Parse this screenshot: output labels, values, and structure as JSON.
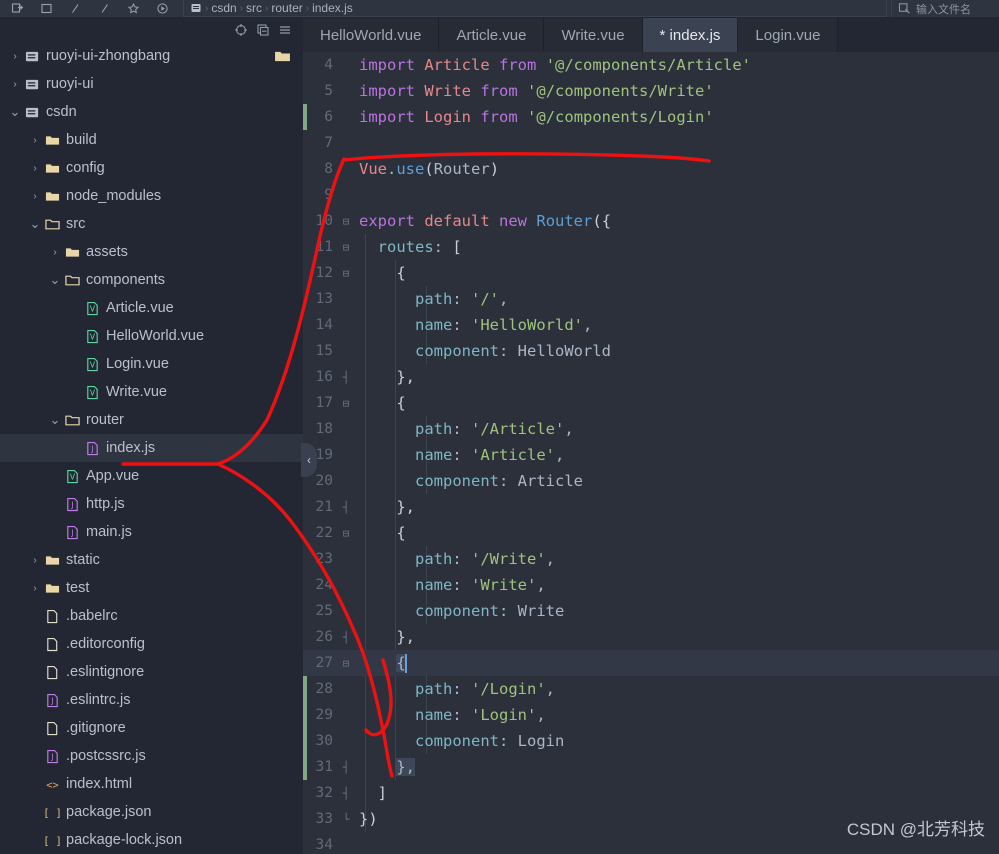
{
  "topbar": {
    "icons": [
      "add-frame-icon",
      "window-icon",
      "backslash-icon",
      "slash-icon",
      "star-icon",
      "run-icon"
    ],
    "breadcrumb_icon": "project-file-icon",
    "breadcrumbs": [
      "csdn",
      "src",
      "router",
      "index.js"
    ],
    "crumb_separator": "›",
    "search_icon": "search-file-icon",
    "search_placeholder": "输入文件名"
  },
  "project_panel": {
    "toolbar_icons": [
      "locate-target-icon",
      "collapse-all-icon",
      "options-menu-icon"
    ],
    "tree": [
      {
        "label": "ruoyi-ui-zhongbang",
        "depth": 0,
        "arrow": "›",
        "icon": "module-icon",
        "selected": false,
        "trailing_icon": "folder-icon"
      },
      {
        "label": "ruoyi-ui",
        "depth": 0,
        "arrow": "›",
        "icon": "module-icon",
        "selected": false
      },
      {
        "label": "csdn",
        "depth": 0,
        "arrow": "⌄",
        "icon": "module-icon",
        "selected": false
      },
      {
        "label": "build",
        "depth": 1,
        "arrow": "›",
        "icon": "folder-icon",
        "selected": false
      },
      {
        "label": "config",
        "depth": 1,
        "arrow": "›",
        "icon": "folder-icon",
        "selected": false
      },
      {
        "label": "node_modules",
        "depth": 1,
        "arrow": "›",
        "icon": "folder-icon",
        "selected": false
      },
      {
        "label": "src",
        "depth": 1,
        "arrow": "⌄",
        "icon": "folder-open-icon",
        "selected": false
      },
      {
        "label": "assets",
        "depth": 2,
        "arrow": "›",
        "icon": "folder-icon",
        "selected": false
      },
      {
        "label": "components",
        "depth": 2,
        "arrow": "⌄",
        "icon": "folder-open-icon",
        "selected": false
      },
      {
        "label": "Article.vue",
        "depth": 3,
        "arrow": "",
        "icon": "vue-file-icon",
        "selected": false
      },
      {
        "label": "HelloWorld.vue",
        "depth": 3,
        "arrow": "",
        "icon": "vue-file-icon",
        "selected": false
      },
      {
        "label": "Login.vue",
        "depth": 3,
        "arrow": "",
        "icon": "vue-file-icon",
        "selected": false
      },
      {
        "label": "Write.vue",
        "depth": 3,
        "arrow": "",
        "icon": "vue-file-icon",
        "selected": false
      },
      {
        "label": "router",
        "depth": 2,
        "arrow": "⌄",
        "icon": "folder-open-icon",
        "selected": false
      },
      {
        "label": "index.js",
        "depth": 3,
        "arrow": "",
        "icon": "js-file-icon",
        "selected": true
      },
      {
        "label": "App.vue",
        "depth": 2,
        "arrow": "",
        "icon": "vue-file-icon",
        "selected": false
      },
      {
        "label": "http.js",
        "depth": 2,
        "arrow": "",
        "icon": "js-file-icon",
        "selected": false
      },
      {
        "label": "main.js",
        "depth": 2,
        "arrow": "",
        "icon": "js-file-icon",
        "selected": false
      },
      {
        "label": "static",
        "depth": 1,
        "arrow": "›",
        "icon": "folder-icon",
        "selected": false
      },
      {
        "label": "test",
        "depth": 1,
        "arrow": "›",
        "icon": "folder-icon",
        "selected": false
      },
      {
        "label": ".babelrc",
        "depth": 1,
        "arrow": "",
        "icon": "plain-file-icon",
        "selected": false
      },
      {
        "label": ".editorconfig",
        "depth": 1,
        "arrow": "",
        "icon": "plain-file-icon",
        "selected": false
      },
      {
        "label": ".eslintignore",
        "depth": 1,
        "arrow": "",
        "icon": "plain-file-icon",
        "selected": false
      },
      {
        "label": ".eslintrc.js",
        "depth": 1,
        "arrow": "",
        "icon": "js-file-icon",
        "selected": false
      },
      {
        "label": ".gitignore",
        "depth": 1,
        "arrow": "",
        "icon": "plain-file-icon",
        "selected": false
      },
      {
        "label": ".postcssrc.js",
        "depth": 1,
        "arrow": "",
        "icon": "js-file-icon",
        "selected": false
      },
      {
        "label": "index.html",
        "depth": 1,
        "arrow": "",
        "icon": "html-file-icon",
        "selected": false
      },
      {
        "label": "package.json",
        "depth": 1,
        "arrow": "",
        "icon": "json-file-icon",
        "selected": false
      },
      {
        "label": "package-lock.json",
        "depth": 1,
        "arrow": "",
        "icon": "json-file-icon",
        "selected": false
      }
    ]
  },
  "editor": {
    "tabs": [
      {
        "label": "HelloWorld.vue",
        "active": false
      },
      {
        "label": "Article.vue",
        "active": false
      },
      {
        "label": "Write.vue",
        "active": false
      },
      {
        "label": "* index.js",
        "active": true
      },
      {
        "label": "Login.vue",
        "active": false
      }
    ],
    "first_line_number": 4,
    "caret_line": 27,
    "collapse_handle_icon": "chevron-left-icon",
    "changed_line_ranges": [
      [
        6,
        6
      ],
      [
        27,
        31
      ]
    ],
    "lines": [
      {
        "n": 4,
        "fold": "",
        "tokens": [
          [
            "imp",
            "import"
          ],
          [
            "pln",
            " "
          ],
          [
            "cls",
            "Article"
          ],
          [
            "pln",
            " "
          ],
          [
            "imp",
            "from"
          ],
          [
            "pln",
            " "
          ],
          [
            "str",
            "'@/components/Article'"
          ]
        ]
      },
      {
        "n": 5,
        "fold": "",
        "tokens": [
          [
            "imp",
            "import"
          ],
          [
            "pln",
            " "
          ],
          [
            "cls",
            "Write"
          ],
          [
            "pln",
            " "
          ],
          [
            "imp",
            "from"
          ],
          [
            "pln",
            " "
          ],
          [
            "str",
            "'@/components/Write'"
          ]
        ]
      },
      {
        "n": 6,
        "fold": "",
        "tokens": [
          [
            "imp",
            "import"
          ],
          [
            "pln",
            " "
          ],
          [
            "cls",
            "Login"
          ],
          [
            "pln",
            " "
          ],
          [
            "imp",
            "from"
          ],
          [
            "pln",
            " "
          ],
          [
            "str",
            "'@/components/Login'"
          ]
        ]
      },
      {
        "n": 7,
        "fold": "",
        "tokens": []
      },
      {
        "n": 8,
        "fold": "",
        "tokens": [
          [
            "cls",
            "Vue"
          ],
          [
            "pln",
            "."
          ],
          [
            "fn",
            "use"
          ],
          [
            "brc",
            "("
          ],
          [
            "pln",
            "Router"
          ],
          [
            "brc",
            ")"
          ]
        ]
      },
      {
        "n": 9,
        "fold": "",
        "tokens": []
      },
      {
        "n": 10,
        "fold": "⊟",
        "tokens": [
          [
            "imp",
            "export"
          ],
          [
            "pln",
            " "
          ],
          [
            "cls",
            "default"
          ],
          [
            "pln",
            " "
          ],
          [
            "imp",
            "new"
          ],
          [
            "pln",
            " "
          ],
          [
            "fn",
            "Router"
          ],
          [
            "brc",
            "({"
          ]
        ]
      },
      {
        "n": 11,
        "fold": "⊟",
        "tokens": [
          [
            "pln",
            "  "
          ],
          [
            "prop",
            "routes"
          ],
          [
            "pln",
            ": "
          ],
          [
            "brc",
            "["
          ]
        ]
      },
      {
        "n": 12,
        "fold": "⊟",
        "tokens": [
          [
            "pln",
            "    "
          ],
          [
            "brc",
            "{"
          ]
        ]
      },
      {
        "n": 13,
        "fold": "",
        "tokens": [
          [
            "pln",
            "      "
          ],
          [
            "prop",
            "path"
          ],
          [
            "pln",
            ": "
          ],
          [
            "str",
            "'/'"
          ],
          [
            "pln",
            ","
          ]
        ]
      },
      {
        "n": 14,
        "fold": "",
        "tokens": [
          [
            "pln",
            "      "
          ],
          [
            "prop",
            "name"
          ],
          [
            "pln",
            ": "
          ],
          [
            "str",
            "'HelloWorld'"
          ],
          [
            "pln",
            ","
          ]
        ]
      },
      {
        "n": 15,
        "fold": "",
        "tokens": [
          [
            "pln",
            "      "
          ],
          [
            "prop",
            "component"
          ],
          [
            "pln",
            ": "
          ],
          [
            "pln",
            "HelloWorld"
          ]
        ]
      },
      {
        "n": 16,
        "fold": "┤",
        "tokens": [
          [
            "pln",
            "    "
          ],
          [
            "brc",
            "},"
          ]
        ]
      },
      {
        "n": 17,
        "fold": "⊟",
        "tokens": [
          [
            "pln",
            "    "
          ],
          [
            "brc",
            "{"
          ]
        ]
      },
      {
        "n": 18,
        "fold": "",
        "tokens": [
          [
            "pln",
            "      "
          ],
          [
            "prop",
            "path"
          ],
          [
            "pln",
            ": "
          ],
          [
            "str",
            "'/Article'"
          ],
          [
            "pln",
            ","
          ]
        ]
      },
      {
        "n": 19,
        "fold": "",
        "tokens": [
          [
            "pln",
            "      "
          ],
          [
            "prop",
            "name"
          ],
          [
            "pln",
            ": "
          ],
          [
            "str",
            "'Article'"
          ],
          [
            "pln",
            ","
          ]
        ]
      },
      {
        "n": 20,
        "fold": "",
        "tokens": [
          [
            "pln",
            "      "
          ],
          [
            "prop",
            "component"
          ],
          [
            "pln",
            ": "
          ],
          [
            "pln",
            "Article"
          ]
        ]
      },
      {
        "n": 21,
        "fold": "┤",
        "tokens": [
          [
            "pln",
            "    "
          ],
          [
            "brc",
            "},"
          ]
        ]
      },
      {
        "n": 22,
        "fold": "⊟",
        "tokens": [
          [
            "pln",
            "    "
          ],
          [
            "brc",
            "{"
          ]
        ]
      },
      {
        "n": 23,
        "fold": "",
        "tokens": [
          [
            "pln",
            "      "
          ],
          [
            "prop",
            "path"
          ],
          [
            "pln",
            ": "
          ],
          [
            "str",
            "'/Write'"
          ],
          [
            "pln",
            ","
          ]
        ]
      },
      {
        "n": 24,
        "fold": "",
        "tokens": [
          [
            "pln",
            "      "
          ],
          [
            "prop",
            "name"
          ],
          [
            "pln",
            ": "
          ],
          [
            "str",
            "'Write'"
          ],
          [
            "pln",
            ","
          ]
        ]
      },
      {
        "n": 25,
        "fold": "",
        "tokens": [
          [
            "pln",
            "      "
          ],
          [
            "prop",
            "component"
          ],
          [
            "pln",
            ": "
          ],
          [
            "pln",
            "Write"
          ]
        ]
      },
      {
        "n": 26,
        "fold": "┤",
        "tokens": [
          [
            "pln",
            "    "
          ],
          [
            "brc",
            "},"
          ]
        ]
      },
      {
        "n": 27,
        "fold": "⊟",
        "tokens": [
          [
            "pln",
            "    "
          ],
          [
            "brmatch",
            "{"
          ]
        ]
      },
      {
        "n": 28,
        "fold": "",
        "tokens": [
          [
            "pln",
            "      "
          ],
          [
            "prop",
            "path"
          ],
          [
            "pln",
            ": "
          ],
          [
            "str",
            "'/Login'"
          ],
          [
            "pln",
            ","
          ]
        ]
      },
      {
        "n": 29,
        "fold": "",
        "tokens": [
          [
            "pln",
            "      "
          ],
          [
            "prop",
            "name"
          ],
          [
            "pln",
            ": "
          ],
          [
            "str",
            "'Login'"
          ],
          [
            "pln",
            ","
          ]
        ]
      },
      {
        "n": 30,
        "fold": "",
        "tokens": [
          [
            "pln",
            "      "
          ],
          [
            "prop",
            "component"
          ],
          [
            "pln",
            ": "
          ],
          [
            "pln",
            "Login"
          ]
        ]
      },
      {
        "n": 31,
        "fold": "┤",
        "tokens": [
          [
            "pln",
            "    "
          ],
          [
            "brmatch",
            "},"
          ]
        ]
      },
      {
        "n": 32,
        "fold": "┤",
        "tokens": [
          [
            "pln",
            "  "
          ],
          [
            "brc",
            "]"
          ]
        ]
      },
      {
        "n": 33,
        "fold": "└",
        "tokens": [
          [
            "brc",
            "})"
          ]
        ]
      },
      {
        "n": 34,
        "fold": "",
        "tokens": []
      }
    ]
  },
  "annotation": {
    "color": "#ee1111",
    "name": "red-pen-markup"
  },
  "watermark": {
    "text": "CSDN @北芳科技"
  },
  "colors": {
    "panel_bg": "#232733",
    "editor_bg": "#2b303b",
    "tab_active_bg": "#3b4252",
    "selection_bg": "#2f3441",
    "accent_red": "#ee1111",
    "change_green": "#93bb93",
    "string_green": "#9fc37e",
    "keyword_purple": "#bb72e0",
    "class_salmon": "#e8878a",
    "prop_teal": "#7fb6c4",
    "fn_blue": "#5f9fd6"
  }
}
